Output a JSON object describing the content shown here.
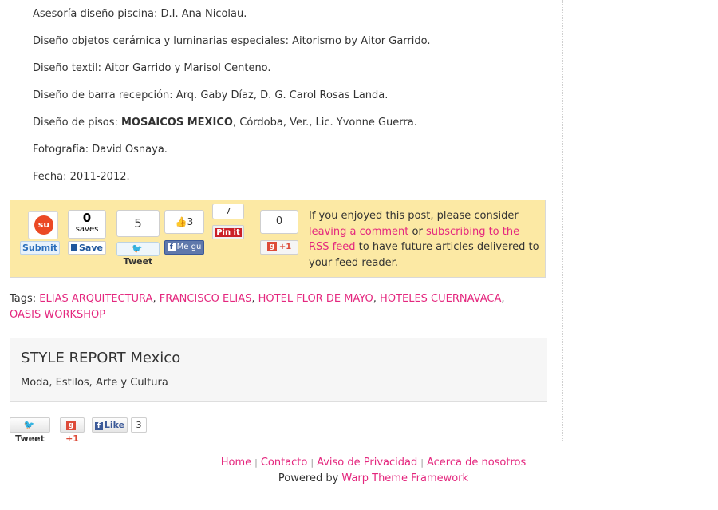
{
  "credits": {
    "pool": "Asesoría diseño piscina: D.I. Ana Nicolau.",
    "ceramics": "Diseño objetos cerámica y luminarias especiales: Aitorismo by Aitor Garrido.",
    "textile": "Diseño textil: Aitor Garrido y Marisol Centeno.",
    "bar": "Diseño de barra recepción: Arq. Gaby Díaz, D. G. Carol Rosas Landa.",
    "floors_prefix": "Diseño de pisos: ",
    "floors_bold": "MOSAICOS MEXICO",
    "floors_suffix": ", Córdoba, Ver., Lic. Yvonne Guerra.",
    "photo": "Fotografía: David Osnaya.",
    "date": "Fecha: 2011-2012."
  },
  "share": {
    "stumble_label": "Submit",
    "saves_count": "0",
    "saves_label": "saves",
    "save_button": "Save",
    "tweet_count": "5",
    "tweet_button": "Tweet",
    "fb_count": "3",
    "fb_button": "Me gu",
    "pin_count": "7",
    "pin_button": "Pin it",
    "gplus_count": "0",
    "gplus_button": "+1",
    "enjoy_prefix": "If you enjoyed this post, please consider ",
    "leave_comment": "leaving a comment",
    "or": " or ",
    "subscribe_rss": "subscribing to the RSS feed",
    "enjoy_suffix": " to have future articles delivered to your feed reader."
  },
  "tags": {
    "label": "Tags: ",
    "items": [
      "ELIAS ARQUITECTURA",
      "FRANCISCO ELIAS",
      "HOTEL FLOR DE MAYO",
      "HOTELES CUERNAVACA",
      "OASIS WORKSHOP"
    ],
    "separator": ", "
  },
  "author": {
    "title": "STYLE REPORT Mexico",
    "subtitle": "Moda, Estilos, Arte y Cultura"
  },
  "bottom_share": {
    "tweet": "Tweet",
    "gplus": "+1",
    "like": "Like",
    "like_count": "3"
  },
  "footer": {
    "links": [
      "Home",
      "Contacto",
      "Aviso de Privacidad",
      "Acerca de nosotros"
    ],
    "separator": "|",
    "powered_prefix": "Powered by ",
    "powered_link": "Warp Theme Framework"
  }
}
